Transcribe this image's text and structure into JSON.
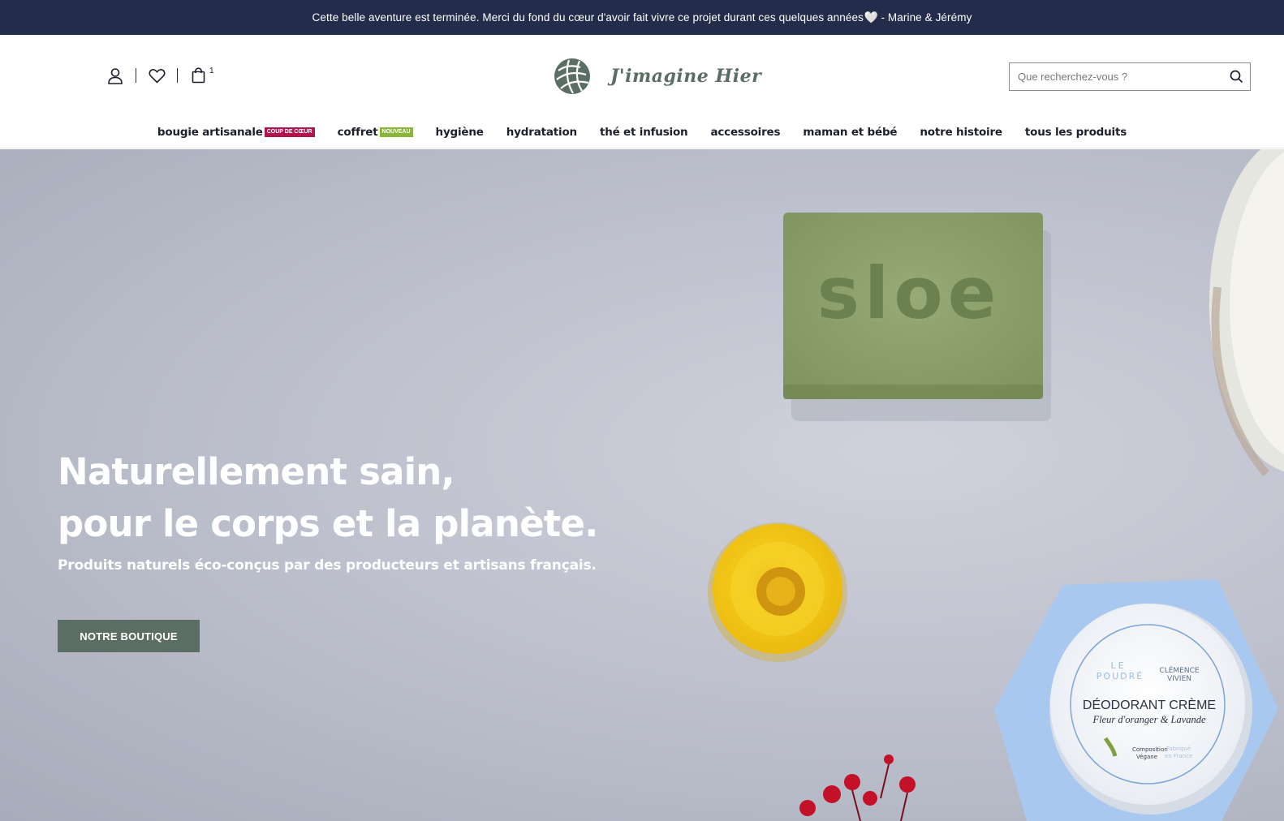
{
  "announcement": {
    "text": "Cette belle aventure est terminée. Merci du fond du cœur d'avoir fait vivre ce projet durant ces quelques années",
    "heart": "🤍",
    "signature": " - Marine & Jérémy"
  },
  "header": {
    "account_icon": "user-icon",
    "wishlist_icon": "heart-icon",
    "cart_icon": "shopping-bag-icon",
    "cart_count": "1",
    "logo_text": "J'imagine Hier",
    "search_placeholder": "Que recherchez-vous ?",
    "search_icon": "search-icon"
  },
  "nav": {
    "items": [
      {
        "label": "bougie artisanale",
        "badge": "COUP DE CŒUR",
        "badge_color": "#b0134e"
      },
      {
        "label": "coffret",
        "badge": "NOUVEAU",
        "badge_color": "#8bb53a"
      },
      {
        "label": "hygiène"
      },
      {
        "label": "hydratation"
      },
      {
        "label": "thé et infusion"
      },
      {
        "label": "accessoires"
      },
      {
        "label": "maman et bébé"
      },
      {
        "label": "notre histoire"
      },
      {
        "label": "tous les produits"
      }
    ]
  },
  "hero": {
    "title_line1": "Naturellement sain,",
    "title_line2": "pour le corps et la planète.",
    "subtitle": "Produits naturels éco-conçus par des producteurs et artisans français.",
    "button_label": "NOTRE BOUTIQUE",
    "soap_text": "sloe",
    "jar_brand_left_1": "LE",
    "jar_brand_left_2": "POUDRÉ",
    "jar_brand_right_1": "CLÉMENCE",
    "jar_brand_right_2": "VIVIEN",
    "jar_title": "DÉODORANT CRÈME",
    "jar_subtitle": "Fleur d'oranger & Lavande",
    "jar_badge_1": "Composition",
    "jar_badge_2": "Végane",
    "jar_badge_3": "Fabriqué",
    "jar_badge_4": "en France"
  },
  "colors": {
    "announcement_bg": "#232d4b",
    "brand_green": "#5b6e64",
    "soap_green": "#8ea06d",
    "flower_yellow": "#f2c914",
    "berry_red": "#c4112a",
    "jar_blue": "#a9c8ef"
  }
}
